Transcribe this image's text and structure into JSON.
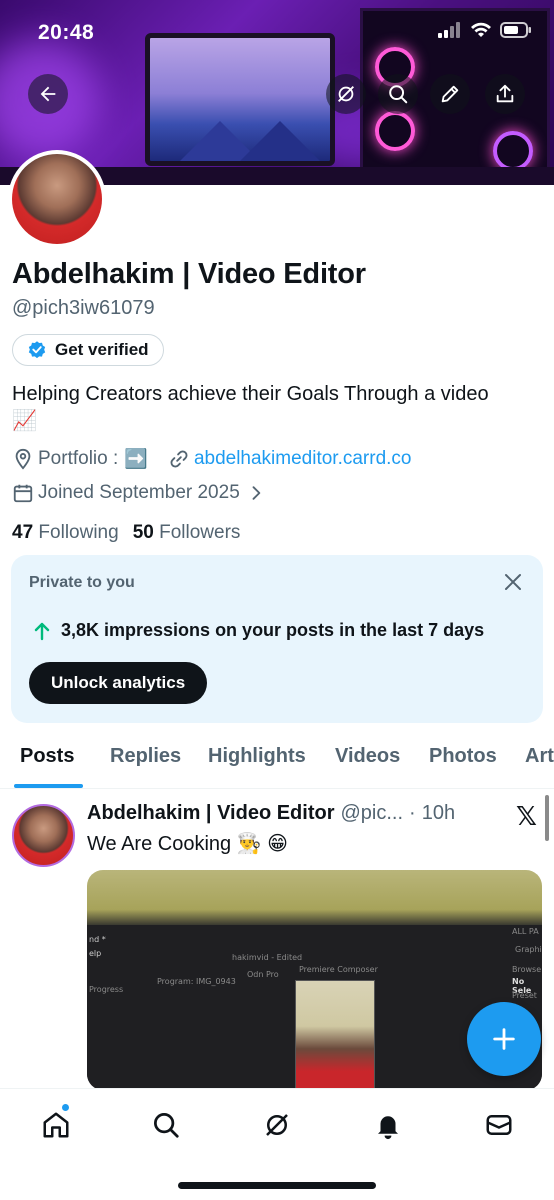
{
  "status_bar": {
    "time": "20:48"
  },
  "header_icons": [
    "back-arrow-icon",
    "grok-icon",
    "search-icon",
    "edit-icon",
    "share-icon"
  ],
  "profile": {
    "name": "Abdelhakim | Video Editor",
    "handle": "@pich3iw61079",
    "get_verified_label": "Get verified",
    "bio": "Helping Creators achieve their Goals Through a video",
    "bio_emoji": "📈",
    "portfolio_label": "Portfolio :",
    "portfolio_emoji": "➡️",
    "website": "abdelhakimeditor.carrd.co",
    "joined": "Joined September 2025",
    "following_count": "47",
    "following_label": "Following",
    "followers_count": "50",
    "followers_label": "Followers"
  },
  "private_card": {
    "title": "Private to you",
    "impressions_text": "3,8K impressions on your posts in the last 7 days",
    "button_label": "Unlock analytics"
  },
  "tabs": [
    {
      "label": "Posts",
      "active": true
    },
    {
      "label": "Replies",
      "active": false
    },
    {
      "label": "Highlights",
      "active": false
    },
    {
      "label": "Videos",
      "active": false
    },
    {
      "label": "Photos",
      "active": false
    },
    {
      "label": "Art",
      "active": false
    }
  ],
  "post": {
    "author": "Abdelhakim | Video Editor",
    "handle": "@pic...",
    "separator": "·",
    "time": "10h",
    "text": "We Are Cooking 👨‍🍳 😁",
    "media": {
      "menu_lines": [
        "nd *",
        "elp"
      ],
      "project_name": "hakimvid - Edited",
      "panel_labels": [
        "Progress",
        "Program: IMG_0943",
        "Odn Pro",
        "Premiere Composer"
      ],
      "right_labels": [
        "ALL PA",
        "Graphics",
        "Browse",
        "No Sele",
        "Preset"
      ]
    }
  },
  "fab": {
    "icon": "plus-icon"
  },
  "bottom_nav": [
    "home-icon",
    "search-icon",
    "grok-icon",
    "notifications-icon",
    "messages-icon"
  ],
  "colors": {
    "accent": "#1d9bf0",
    "text": "#0f1419",
    "secondary": "#536471",
    "card_bg": "#e8f5fd",
    "impression_arrow": "#00ba7c"
  }
}
